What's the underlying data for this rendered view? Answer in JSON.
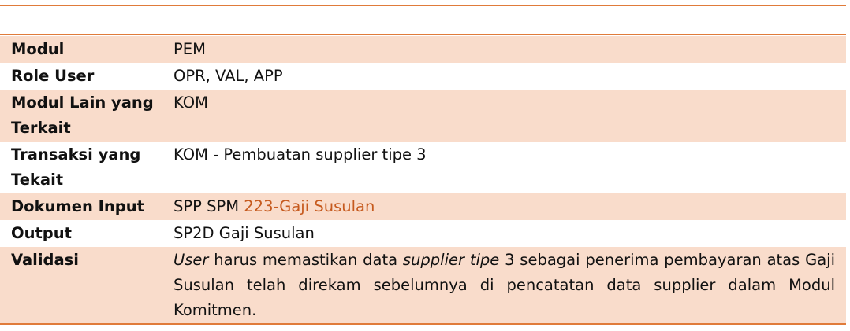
{
  "rows": [
    {
      "label": "Modul",
      "value": "PEM"
    },
    {
      "label": "Role User",
      "value": "OPR, VAL, APP"
    },
    {
      "label": "Modul Lain yang Terkait",
      "value": "KOM"
    },
    {
      "label": "Transaksi yang Tekait",
      "value": "KOM - Pembuatan supplier tipe 3"
    },
    {
      "label": "Dokumen Input",
      "value_prefix": "SPP SPM ",
      "value_highlight": "223-Gaji Susulan"
    },
    {
      "label": "Output",
      "value": "SP2D Gaji Susulan"
    },
    {
      "label": "Validasi",
      "value_parts": [
        "User",
        " harus memastikan data ",
        "supplier tipe",
        " 3 sebagai penerima pembayaran atas Gaji Susulan telah direkam sebelumnya di pencatatan data supplier dalam Modul Komitmen."
      ]
    }
  ],
  "colors": {
    "accent_rule": "#e07b3a",
    "row_shade": "#f9dccb",
    "highlight_text": "#c65a1e"
  }
}
